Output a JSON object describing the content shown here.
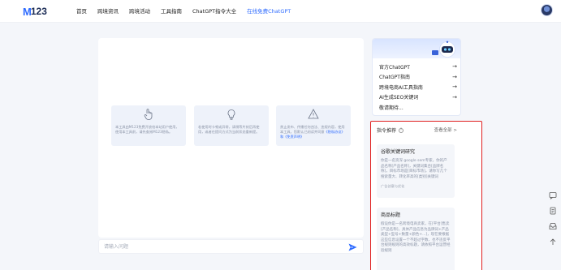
{
  "brand": {
    "logo_m": "M",
    "logo_num": "123"
  },
  "nav": [
    {
      "label": "首页",
      "active": false
    },
    {
      "label": "跨境资讯",
      "active": false
    },
    {
      "label": "跨境活动",
      "active": false
    },
    {
      "label": "工具指南",
      "active": false
    },
    {
      "label": "ChatGPT指令大全",
      "active": false
    },
    {
      "label": "在线免费ChatGPT",
      "active": true
    }
  ],
  "info_cards": [
    {
      "icon": "hand-pointer-icon",
      "text": "本工具由M123免费开放给本站用户使用，使用本工具前，请先查阅M123隐私。",
      "link": "",
      "suffix": ""
    },
    {
      "icon": "lightbulb-icon",
      "text": "若使用时卡顿或异常，请稍等片刻后再使用，或者在提问方式为当前状态重新提。",
      "link": "",
      "suffix": ""
    },
    {
      "icon": "warning-icon",
      "text": "禁止发布、传播任何违法、违规内容，使用本工具，您默认已阅读并同意",
      "link": "《隐私协议》",
      "suffix": "和《免责声明》"
    }
  ],
  "input": {
    "placeholder": "请输入问题",
    "value": ""
  },
  "quick_links": [
    {
      "label": "官方ChatGPT"
    },
    {
      "label": "ChatGPT指南"
    },
    {
      "label": "跨境电商AI工具指南"
    },
    {
      "label": "AI生成SEO关键词"
    },
    {
      "label": "敬请期待..."
    }
  ],
  "recommend": {
    "title": "指令推荐",
    "more": "查看全部 >",
    "items": [
      {
        "title": "谷歌关键词研究",
        "desc": "你是一名资深 google sem专家，你的产品名称[产品名称]，关键词集合[品牌名称]，目标市场是[目标市场]，请你写几个搜索量大、转化率高的[类别]关键词",
        "tag": "广告创意与优化"
      },
      {
        "title": "商品标题",
        "desc": "假设你是一名跨境电商卖家，在[平台]售卖[产品名称]，具体产品信息为品牌词+产品类型+型号+数量+颜色+...]，现在要根据这些信息设置一个不超过字数、也不违反平台规则规则的高效标题，请依照平台运营经验规则",
        "tag": ""
      }
    ]
  },
  "colors": {
    "accent": "#2e6bff",
    "highlight_border": "#e02020",
    "page_bg": "#f4f6fa"
  }
}
